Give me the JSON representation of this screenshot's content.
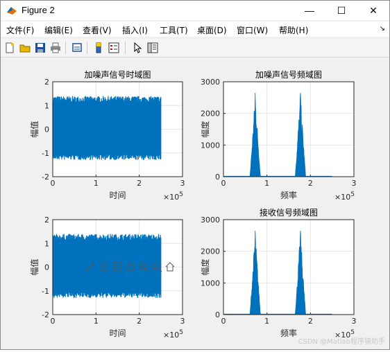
{
  "window": {
    "title": "Figure 2",
    "controls": {
      "minimize": "—",
      "maximize": "☐",
      "close": "✕"
    }
  },
  "menu": {
    "items": [
      "文件(F)",
      "编辑(E)",
      "查看(V)",
      "插入(I)",
      "工具(T)",
      "桌面(D)",
      "窗口(W)",
      "帮助(H)"
    ],
    "arrow": "↘"
  },
  "toolbar": {
    "icons": [
      "new-figure-icon",
      "open-file-icon",
      "save-icon",
      "print-icon",
      "link-plot-icon",
      "insert-colorbar-icon",
      "insert-legend-icon",
      "pointer-icon",
      "property-inspector-icon"
    ]
  },
  "axes_toolbar": {
    "icons": [
      "brush-icon",
      "data-tips-icon",
      "restore-view-icon",
      "pan-icon",
      "zoom-in-icon",
      "zoom-out-icon",
      "home-icon"
    ]
  },
  "colors": {
    "signal": "#0072bd",
    "grid": "#e6e6e6",
    "axes": "#262626",
    "figure_bg": "#f0f0f0"
  },
  "chart_data": [
    {
      "type": "area",
      "title": "加噪声信号时域图",
      "xlabel": "时间",
      "ylabel": "幅值",
      "xlim": [
        0,
        300000
      ],
      "ylim": [
        -2,
        2
      ],
      "xticks": [
        "0",
        "1",
        "2",
        "3"
      ],
      "yticks": [
        "2",
        "1",
        "0",
        "-1",
        "-2"
      ],
      "exponent": "×10^5",
      "grid": true,
      "series": [
        {
          "x": [
            0,
            250000
          ],
          "envelope": [
            -1.3,
            1.4
          ],
          "description_values": {
            "min": -1.3,
            "max": 1.4,
            "end_x": 250000
          }
        }
      ]
    },
    {
      "type": "area",
      "title": "加噪声信号频域图",
      "xlabel": "频率",
      "ylabel": "幅度",
      "xlim": [
        0,
        300000
      ],
      "ylim": [
        0,
        3000
      ],
      "xticks": [
        "0",
        "1",
        "2",
        "3"
      ],
      "yticks": [
        "3000",
        "2000",
        "1000",
        "0"
      ],
      "exponent": "×10^5",
      "grid": true,
      "series": [
        {
          "peaks": [
            {
              "center": 73000,
              "height": 2650,
              "width": 12000
            },
            {
              "center": 177000,
              "height": 2650,
              "width": 12000
            }
          ],
          "xend": 250000
        }
      ]
    },
    {
      "type": "area",
      "title": "",
      "xlabel": "时间",
      "ylabel": "幅值",
      "xlim": [
        0,
        300000
      ],
      "ylim": [
        -2,
        2
      ],
      "xticks": [
        "0",
        "1",
        "2",
        "3"
      ],
      "yticks": [
        "2",
        "1",
        "0",
        "-1",
        "-2"
      ],
      "exponent": "×10^5",
      "grid": true,
      "series": [
        {
          "x": [
            0,
            250000
          ],
          "envelope": [
            -1.3,
            1.4
          ],
          "description_values": {
            "min": -1.3,
            "max": 1.4,
            "end_x": 250000
          }
        }
      ]
    },
    {
      "type": "area",
      "title": "接收信号频域图",
      "xlabel": "频率",
      "ylabel": "幅度",
      "xlim": [
        0,
        300000
      ],
      "ylim": [
        0,
        3000
      ],
      "xticks": [
        "0",
        "1",
        "2",
        "3"
      ],
      "yticks": [
        "3000",
        "2000",
        "1000",
        "0"
      ],
      "exponent": "×10^5",
      "grid": true,
      "series": [
        {
          "peaks": [
            {
              "center": 73000,
              "height": 2650,
              "width": 12000
            },
            {
              "center": 177000,
              "height": 2650,
              "width": 12000
            }
          ],
          "xend": 250000
        }
      ]
    }
  ],
  "watermark": "CSDN @Matlab程序猿助手"
}
